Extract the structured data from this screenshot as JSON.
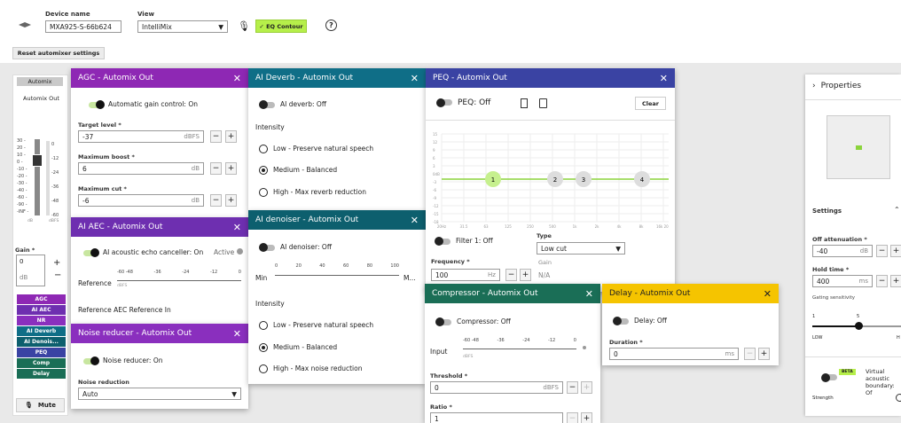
{
  "header": {
    "device_label": "Device name",
    "device_value": "MXA925-S-66b624",
    "view_label": "View",
    "view_value": "IntelliMix",
    "eq_contour": "✓ EQ Contour",
    "help": "?",
    "reset": "Reset automixer settings"
  },
  "left": {
    "tab": "Automix",
    "out": "Automix Out",
    "scale_left": [
      "30 -",
      "20 -",
      "10 -",
      "0 -",
      "-10 -",
      "-20 -",
      "-30 -",
      "-40 -",
      "-60 -",
      "-90 -",
      "-INF -"
    ],
    "scale_right": [
      "0",
      "-12",
      "-24",
      "-36",
      "-48",
      "-60"
    ],
    "db_lbl": "dB",
    "dbfs_lbl": "dBFS",
    "gain_label": "Gain *",
    "gain_value": "0",
    "gain_unit": "dB",
    "nav": [
      "AGC",
      "AI AEC",
      "NR",
      "AI Deverb",
      "AI Denois...",
      "PEQ",
      "Comp",
      "Delay"
    ],
    "mute": "Mute"
  },
  "agc": {
    "title": "AGC - Automix Out",
    "toggle": "Automatic gain control: On",
    "target_label": "Target level *",
    "target_value": "-37",
    "target_unit": "dBFS",
    "boost_label": "Maximum boost *",
    "boost_value": "6",
    "boost_unit": "dB",
    "cut_label": "Maximum cut *",
    "cut_value": "-6",
    "cut_unit": "dB"
  },
  "aec": {
    "title": "AI AEC - Automix Out",
    "toggle": "AI acoustic echo canceller: On",
    "active": "Active",
    "ref_label": "Reference",
    "ticks": [
      "-60 -48",
      "-36",
      "-24",
      "-12",
      "0"
    ],
    "dbfs": "dBFS",
    "ref_text": "Reference  AEC Reference In"
  },
  "nr": {
    "title": "Noise reducer - Automix Out",
    "toggle": "Noise reducer: On",
    "label": "Noise reduction",
    "value": "Auto"
  },
  "deverb": {
    "title": "AI Deverb - Automix Out",
    "toggle": "AI deverb: Off",
    "intensity": "Intensity",
    "opts": [
      "Low - Preserve natural speech",
      "Medium - Balanced",
      "High - Max reverb reduction"
    ]
  },
  "denoiser": {
    "title": "AI denoiser - Automix Out",
    "toggle": "AI denoiser: Off",
    "min": "Min",
    "max": "M...",
    "ticks": [
      "0",
      "20",
      "40",
      "60",
      "80",
      "100"
    ],
    "intensity": "Intensity",
    "opts": [
      "Low - Preserve natural speech",
      "Medium - Balanced",
      "High - Max noise reduction"
    ]
  },
  "peq": {
    "title": "PEQ - Automix Out",
    "toggle": "PEQ: Off",
    "clear": "Clear",
    "yticks": [
      "15",
      "12",
      "9",
      "6",
      "3",
      "0dB",
      "-3",
      "-6",
      "-9",
      "-12",
      "-15",
      "-18"
    ],
    "xticks": [
      "20Hz",
      "31.5",
      "63",
      "125",
      "250",
      "500",
      "1k",
      "2k",
      "4k",
      "8k",
      "16k 20k"
    ],
    "bands": [
      "1",
      "2",
      "3",
      "4"
    ],
    "filter": "Filter 1: Off",
    "type_label": "Type",
    "type_value": "Low cut",
    "freq_label": "Frequency *",
    "freq_value": "100",
    "freq_unit": "Hz",
    "gain_label": "Gain",
    "gain_value": "N/A"
  },
  "comp": {
    "title": "Compressor - Automix Out",
    "toggle": "Compressor: Off",
    "input": "Input",
    "ticks": [
      "-60 -48",
      "-36",
      "-24",
      "-12",
      "0"
    ],
    "dbfs": "dBFS",
    "thr_label": "Threshold *",
    "thr_value": "0",
    "thr_unit": "dBFS",
    "ratio_label": "Ratio *",
    "ratio_value": "1"
  },
  "delay": {
    "title": "Delay - Automix Out",
    "toggle": "Delay: Off",
    "dur_label": "Duration *",
    "dur_value": "0",
    "dur_unit": "ms"
  },
  "props": {
    "title": "Properties",
    "settings": "Settings",
    "off_label": "Off attenuation *",
    "off_value": "-40",
    "off_unit": "dB",
    "hold_label": "Hold time *",
    "hold_value": "400",
    "hold_unit": "ms",
    "gating": "Gating sensitivity",
    "g1": "1",
    "g5": "5",
    "low": "LOW",
    "high": "H",
    "beta": "BETA",
    "virtual": "Virtual acoustic boundary: Of",
    "strength": "Strength"
  },
  "colors": {
    "agc": "#8e28b4",
    "aec": "#6e2fb0",
    "nr": "#8a2fbe",
    "deverb": "#0f6e87",
    "denoiser": "#0d5f6e",
    "peq": "#3a43a3",
    "comp": "#1a6e56",
    "delay": "#f5c400",
    "accent": "#8bd43c"
  }
}
